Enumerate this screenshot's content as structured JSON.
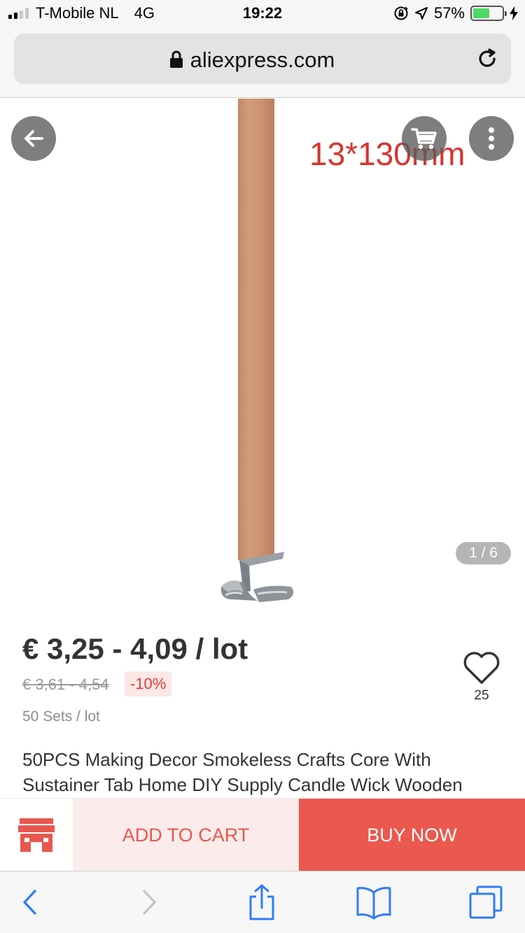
{
  "status_bar": {
    "carrier": "T-Mobile NL",
    "network": "4G",
    "time": "19:22",
    "battery_percent": "57%",
    "battery_level": 0.57,
    "icons": [
      "signal-icon",
      "orientation-lock-icon",
      "location-arrow-icon",
      "battery-icon",
      "charging-bolt-icon"
    ]
  },
  "browser": {
    "url": "aliexpress.com"
  },
  "gallery": {
    "image_label": "13*130mm",
    "counter": "1 / 6",
    "current_image": 1,
    "total_images": 6
  },
  "product": {
    "price": "€ 3,25 - 4,09 / lot",
    "original_price": "€ 3,61 - 4,54",
    "discount": "-10%",
    "lot_size": "50 Sets / lot",
    "wishlist_count": "25",
    "title": "50PCS Making Decor Smokeless Crafts Core With Sustainer Tab Home DIY Supply Candle Wick Wooden"
  },
  "actions": {
    "add_to_cart": "ADD TO CART",
    "buy_now": "BUY NOW"
  },
  "colors": {
    "accent_red": "#ea584e",
    "add_cart_bg": "#fbeceb",
    "discount_text": "#e53a31",
    "safari_blue": "#2f7cf6"
  }
}
